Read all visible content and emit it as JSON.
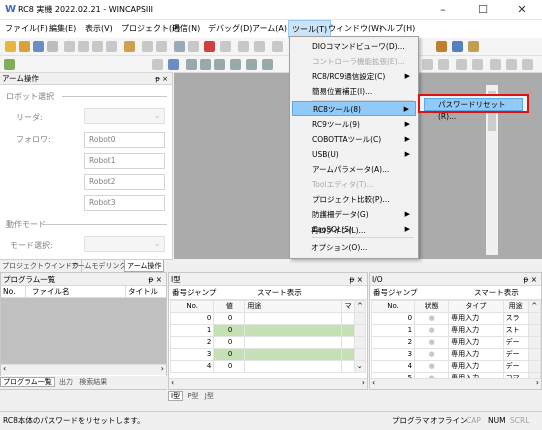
{
  "window": {
    "title": "RC8 実機  2022.02.21 - WINCAPSIII",
    "min": "–",
    "max": "☐",
    "close": "✕"
  },
  "menubar": [
    "ファイル(F)",
    "編集(E)",
    "表示(V)",
    "プロジェクト(P)",
    "通信(N)",
    "デバッグ(D)",
    "アーム(A)",
    "ツール(T)",
    "ウィンドウ(W)",
    "ヘルプ(H)"
  ],
  "arm_panel": {
    "title": "アーム操作",
    "pin": "ᵽ ×",
    "robot_select": "ロボット選択",
    "leader_label": "リーダ:",
    "follower_label": "フォロワ:",
    "followers": [
      "Robot0",
      "Robot1",
      "Robot2",
      "Robot3"
    ],
    "op_mode": "動作モード",
    "mode_select": "モード選択:"
  },
  "arm_tabs": [
    "プロジェクトウインドウ",
    "アームモデリング",
    "アーム操作"
  ],
  "tools_menu": {
    "items": [
      {
        "label": "DIOコマンドビューワ(D)...",
        "enabled": true,
        "sub": false
      },
      {
        "label": "コントローラ機能拡張(E)...",
        "enabled": false,
        "sub": false
      },
      {
        "label": "RC8/RC9通信設定(C)",
        "enabled": true,
        "sub": true
      },
      {
        "label": "簡易位置補正(I)...",
        "enabled": true,
        "sub": false
      },
      {
        "label": "RC8ツール(8)",
        "enabled": true,
        "sub": true,
        "highlighted": true
      },
      {
        "label": "RC9ツール(9)",
        "enabled": true,
        "sub": true
      },
      {
        "label": "COBOTTAツール(C)",
        "enabled": true,
        "sub": true
      },
      {
        "label": "USB(U)",
        "enabled": true,
        "sub": true
      },
      {
        "label": "アームパラメータ(A)...",
        "enabled": true,
        "sub": false
      },
      {
        "label": "Toolエディタ(T)...",
        "enabled": false,
        "sub": false
      },
      {
        "label": "プロジェクト比較(P)...",
        "enabled": true,
        "sub": false
      },
      {
        "label": "防護柵データ(G)",
        "enabled": true,
        "sub": true
      },
      {
        "label": "CaoSQL(S)",
        "enabled": true,
        "sub": true
      },
      {
        "label": "再ログイン(L)...",
        "enabled": true,
        "sub": false
      },
      {
        "label": "オプション(O)...",
        "enabled": true,
        "sub": false
      }
    ],
    "submenu": "パスワードリセット(R)..."
  },
  "program_list": {
    "title": "プログラム一覧",
    "cols": [
      "No.",
      "ファイル名",
      "タイトル"
    ],
    "tabs": [
      "プログラム一覧",
      "出力",
      "検索結果"
    ]
  },
  "i_panel": {
    "title": "I型",
    "jump": "番号ジャンプ",
    "smart": "スマート表示",
    "cols": [
      "No.",
      "値",
      "用途",
      "マ"
    ],
    "rows": [
      [
        "0",
        "0",
        ""
      ],
      [
        "1",
        "0",
        ""
      ],
      [
        "2",
        "0",
        ""
      ],
      [
        "3",
        "0",
        ""
      ],
      [
        "4",
        "0",
        ""
      ]
    ],
    "tabs": [
      "I型",
      "P型",
      "J型"
    ]
  },
  "io_panel": {
    "title": "I/O",
    "jump": "番号ジャンプ",
    "smart": "スマート表示",
    "cols": [
      "No.",
      "状態",
      "タイプ",
      "用途"
    ],
    "rows": [
      [
        "0",
        "専用入力",
        "スラ"
      ],
      [
        "1",
        "専用入力",
        "スト"
      ],
      [
        "2",
        "専用入力",
        "デー"
      ],
      [
        "3",
        "専用入力",
        "デー"
      ],
      [
        "4",
        "専用入力",
        "デー"
      ],
      [
        "5",
        "専用入力",
        "コマ"
      ]
    ]
  },
  "status": {
    "message": "RC8本体のパスワードをリセットします。",
    "program": "プログラマ",
    "offline": "オフライン",
    "cap": "CAP",
    "num": "NUM",
    "scrl": "SCRL"
  }
}
